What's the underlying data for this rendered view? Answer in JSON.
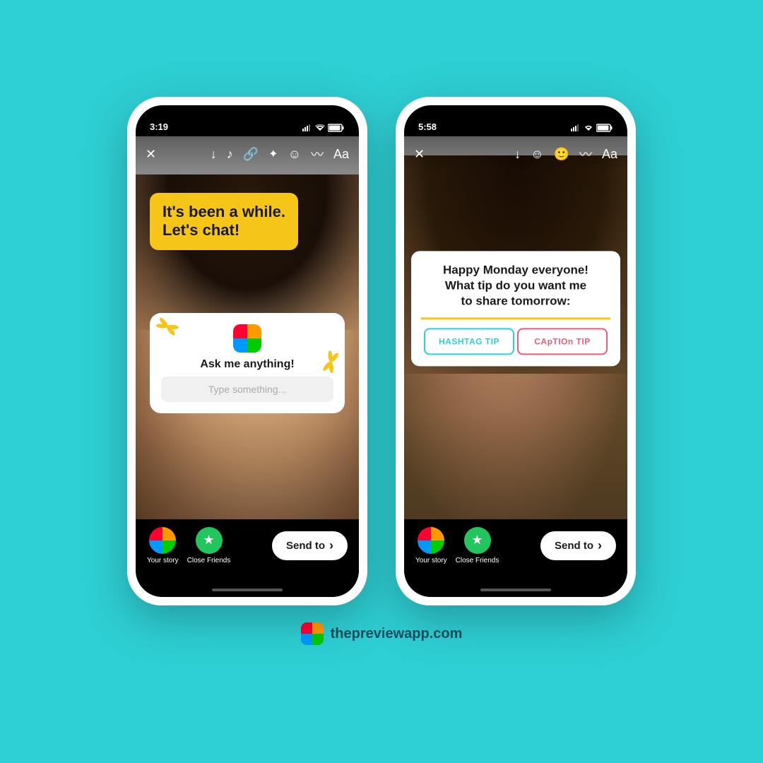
{
  "background_color": "#2ecfd4",
  "phone_left": {
    "time": "3:19",
    "caption": "It's been a while.\nLet's chat!",
    "ask_title": "Ask me anything!",
    "ask_placeholder": "Type something...",
    "your_story_label": "Your story",
    "close_friends_label": "Close Friends",
    "send_to_label": "Send to"
  },
  "phone_right": {
    "time": "5:58",
    "caption": "Happy Monday everyone!\nWhat tip do you want me\nto share tomorrow:",
    "poll_left": "HASHTAG TIP",
    "poll_right": "CApTIOn TIP",
    "your_story_label": "Your story",
    "close_friends_label": "Close Friends",
    "send_to_label": "Send to"
  },
  "footer": {
    "brand_url": "thepreviewapp.com"
  },
  "icons": {
    "close": "✕",
    "download": "↓",
    "music": "♪",
    "link": "🔗",
    "sparkle": "✦",
    "face": "☺",
    "wave": "〰",
    "text": "Aa",
    "star": "★",
    "chevron_right": "›"
  }
}
